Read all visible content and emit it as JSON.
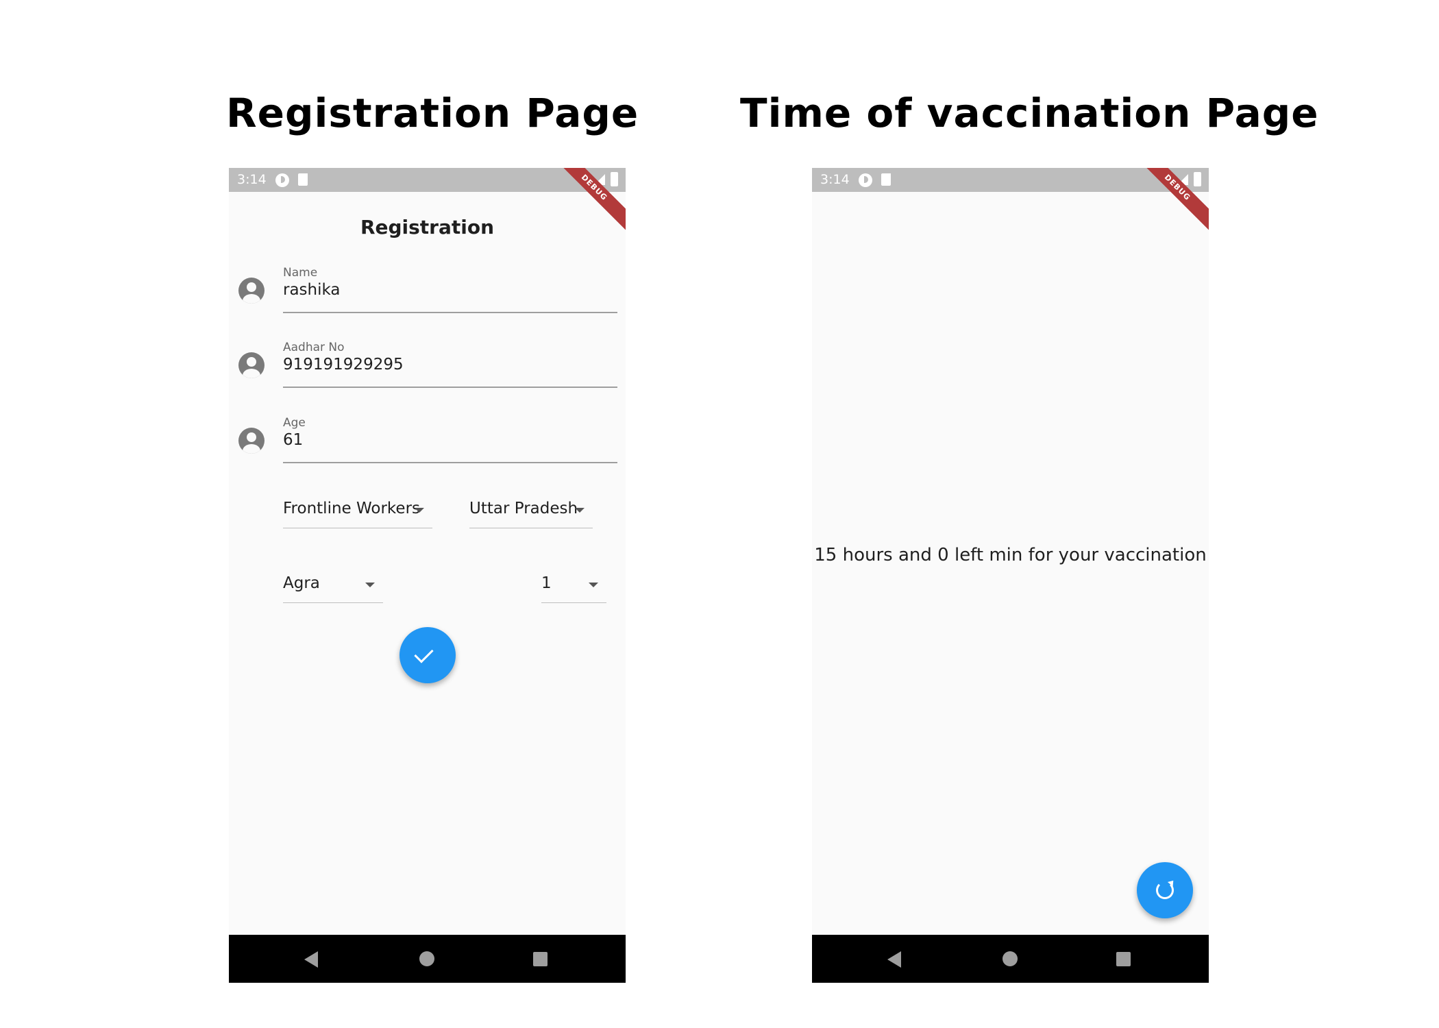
{
  "headings": {
    "left": "Registration Page",
    "right": "Time of vaccination Page"
  },
  "status_bar": {
    "time": "3:14",
    "debug_banner": "DEBUG"
  },
  "registration": {
    "title": "Registration",
    "fields": [
      {
        "label": "Name",
        "value": "rashika"
      },
      {
        "label": "Aadhar No",
        "value": "919191929295"
      },
      {
        "label": "Age",
        "value": "61"
      }
    ],
    "dropdowns": {
      "category": "Frontline Workers",
      "state": "Uttar Pradesh",
      "city": "Agra",
      "dose": "1"
    },
    "submit_icon": "check-icon"
  },
  "vaccination": {
    "message": "15 hours and 0 left min for your vaccination",
    "refresh_icon": "refresh-icon"
  }
}
